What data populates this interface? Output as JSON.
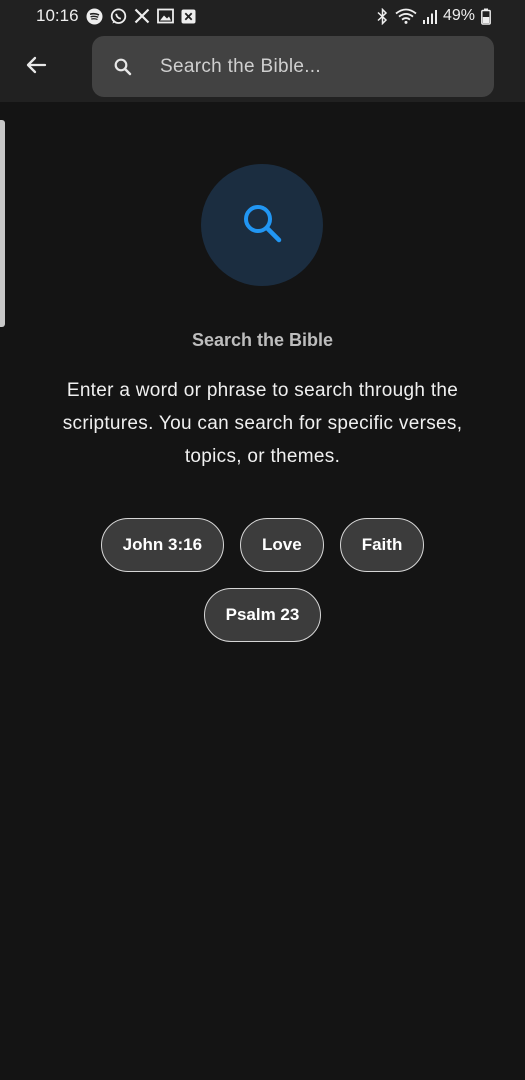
{
  "status_bar": {
    "time": "10:16",
    "battery": "49%",
    "left_icons": [
      "spotify-icon",
      "whatsapp-icon",
      "x-icon",
      "gallery-icon",
      "close-box-icon"
    ],
    "right_icons": [
      "bluetooth-icon",
      "wifi-icon",
      "signal-icon",
      "battery-icon"
    ]
  },
  "header": {
    "back_icon": "arrow-left-icon",
    "search": {
      "placeholder": "Search the Bible...",
      "value": ""
    }
  },
  "empty_state": {
    "icon": "search-icon",
    "title": "Search the Bible",
    "description": "Enter a word or phrase to search through the scriptures. You can search for specific verses, topics, or themes."
  },
  "suggestions": [
    {
      "label": "John 3:16"
    },
    {
      "label": "Love"
    },
    {
      "label": "Faith"
    },
    {
      "label": "Psalm 23"
    }
  ],
  "colors": {
    "background": "#141414",
    "bar": "#212121",
    "accent": "#2196f3",
    "hero_circle": "#1b2d40"
  }
}
